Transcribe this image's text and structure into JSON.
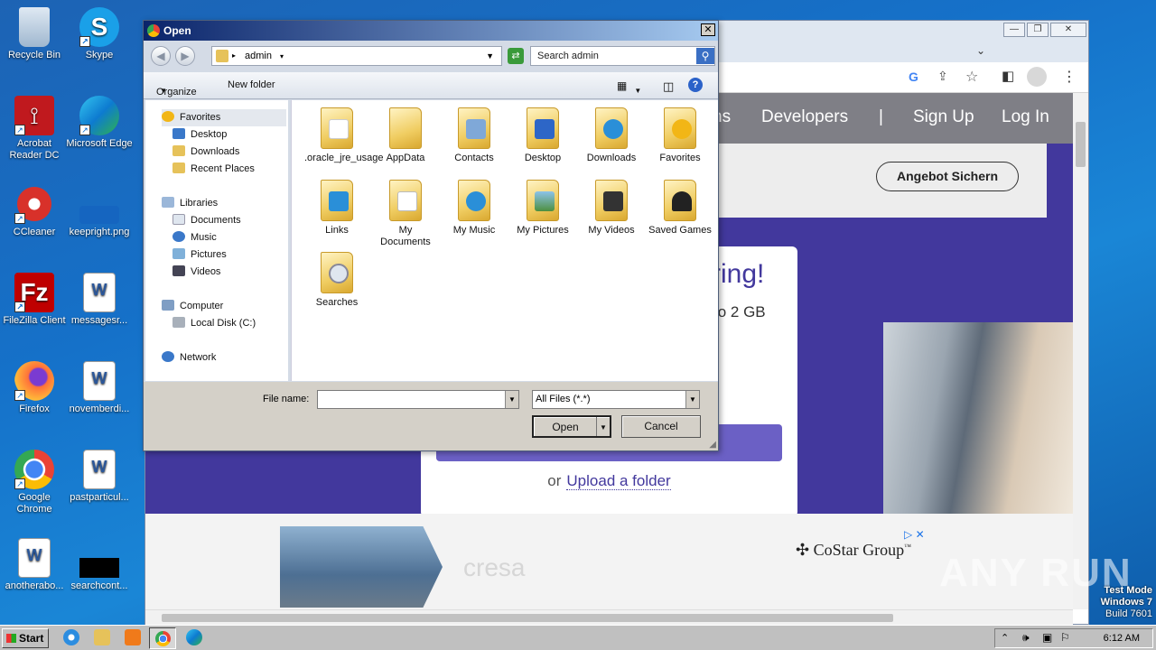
{
  "desktop": {
    "icons": [
      {
        "label": "Recycle Bin"
      },
      {
        "label": "Skype"
      },
      {
        "label": "Acrobat Reader DC"
      },
      {
        "label": "Microsoft Edge"
      },
      {
        "label": "CCleaner"
      },
      {
        "label": "keepright.png"
      },
      {
        "label": "FileZilla Client"
      },
      {
        "label": "messagesr..."
      },
      {
        "label": "Firefox"
      },
      {
        "label": "novemberdi..."
      },
      {
        "label": "Google Chrome"
      },
      {
        "label": "pastparticul..."
      },
      {
        "label": "anotherabo..."
      },
      {
        "label": "searchcont..."
      }
    ]
  },
  "browser": {
    "nav": {
      "item_partial": "ns",
      "developers": "Developers",
      "separator": "|",
      "signup": "Sign Up",
      "login": "Log In"
    },
    "angebot_button": "Angebot Sichern",
    "card": {
      "heading_partial": "ring!",
      "subtext_partial": "to 2 GB",
      "upload_prefix": "or",
      "upload_link": "Upload a folder"
    },
    "ad": {
      "cresa": "cresa",
      "costar": "CoStar Group",
      "costar_tm": "™"
    }
  },
  "dialog": {
    "title": "Open",
    "close": "✕",
    "address": {
      "path": "admin"
    },
    "search": {
      "placeholder": "Search admin"
    },
    "toolbar": {
      "organize": "Organize",
      "new_folder": "New folder"
    },
    "nav_pane": {
      "favorites": "Favorites",
      "desktop": "Desktop",
      "downloads": "Downloads",
      "recent": "Recent Places",
      "libraries": "Libraries",
      "documents": "Documents",
      "music": "Music",
      "pictures": "Pictures",
      "videos": "Videos",
      "computer": "Computer",
      "local_disk": "Local Disk (C:)",
      "network": "Network"
    },
    "files": [
      {
        "name": ".oracle_jre_usage"
      },
      {
        "name": "AppData"
      },
      {
        "name": "Contacts"
      },
      {
        "name": "Desktop"
      },
      {
        "name": "Downloads"
      },
      {
        "name": "Favorites"
      },
      {
        "name": "Links"
      },
      {
        "name": "My Documents"
      },
      {
        "name": "My Music"
      },
      {
        "name": "My Pictures"
      },
      {
        "name": "My Videos"
      },
      {
        "name": "Saved Games"
      },
      {
        "name": "Searches"
      }
    ],
    "file_name_label": "File name:",
    "file_name_value": "",
    "file_type": "All Files (*.*)",
    "open_button": "Open",
    "cancel_button": "Cancel"
  },
  "taskbar": {
    "start": "Start",
    "clock": "6:12 AM"
  },
  "watermark": {
    "line1": "Test Mode",
    "line2": "Windows 7",
    "line3": "Build 7601",
    "anyrun": "ANY RUN"
  }
}
